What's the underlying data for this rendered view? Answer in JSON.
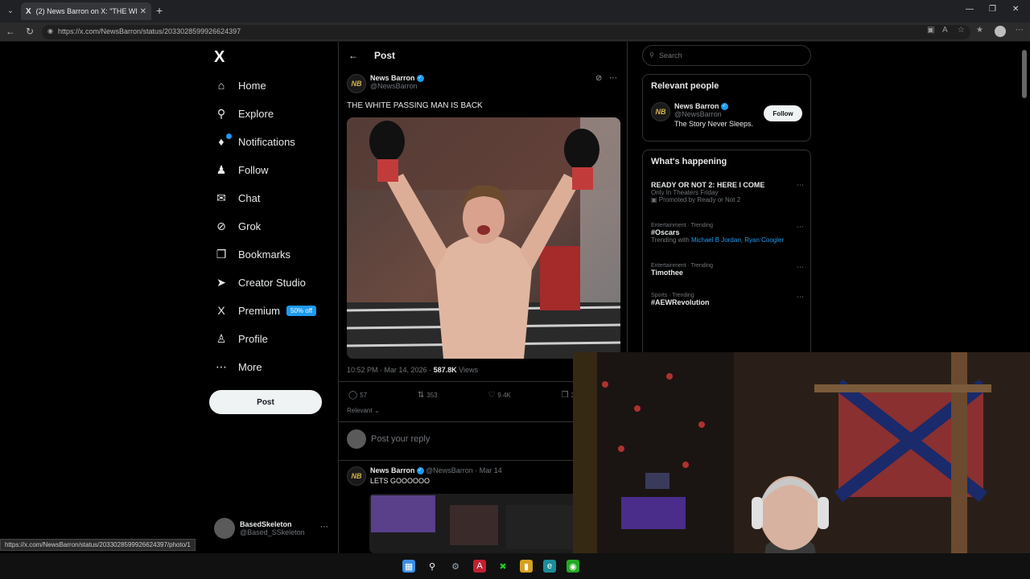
{
  "browser": {
    "tab_title": "(2) News Barron on X: \"THE WHIT",
    "tab_favicon": "X",
    "url": "https://x.com/NewsBarron/status/2033028599926624397",
    "status_url": "https://x.com/NewsBarron/status/2033028599926624397/photo/1"
  },
  "nav": {
    "logo": "X",
    "items": [
      {
        "label": "Home",
        "icon": "home-icon"
      },
      {
        "label": "Explore",
        "icon": "search-icon"
      },
      {
        "label": "Notifications",
        "icon": "bell-icon"
      },
      {
        "label": "Follow",
        "icon": "add-person-icon"
      },
      {
        "label": "Chat",
        "icon": "mail-icon"
      },
      {
        "label": "Grok",
        "icon": "grok-icon"
      },
      {
        "label": "Bookmarks",
        "icon": "bookmark-icon"
      },
      {
        "label": "Creator Studio",
        "icon": "rocket-icon"
      },
      {
        "label": "Premium",
        "icon": "x-icon"
      },
      {
        "label": "Profile",
        "icon": "person-icon"
      },
      {
        "label": "More",
        "icon": "more-circle-icon"
      }
    ],
    "premium_badge": "50% off",
    "post_button": "Post"
  },
  "account": {
    "name": "BasedSkeleton",
    "handle": "@Based_SSkeleton"
  },
  "post": {
    "header_title": "Post",
    "author_avatar": "NB",
    "author_name": "News Barron",
    "author_handle": "@NewsBarron",
    "text": "THE WHITE PASSING MAN IS BACK",
    "time": "10:52 PM · Mar 14, 2026 ·",
    "views": "587.8K",
    "views_label": "Views",
    "replies": "57",
    "reposts": "353",
    "likes": "9.4K",
    "bookmarks": "361",
    "sort_label": "Relevant"
  },
  "reply_box": {
    "placeholder": "Post your reply"
  },
  "reply": {
    "name": "News Barron",
    "handle_date": "@NewsBarron · Mar 14",
    "text": "LETS GOOOOOO"
  },
  "right": {
    "search_placeholder": "Search",
    "relevant_title": "Relevant people",
    "person": {
      "name": "News Barron",
      "handle": "@NewsBarron",
      "bio": "The Story Never Sleeps."
    },
    "follow_label": "Follow",
    "happening_title": "What's happening",
    "trends": [
      {
        "category": "",
        "title": "READY OR NOT 2: HERE I COME",
        "sub": "Only In Theaters Friday",
        "sub2": "Promoted by Ready or Not 2"
      },
      {
        "category": "Entertainment · Trending",
        "title": "#Oscars",
        "sub": "Trending with",
        "links": "Michael B Jordan, Ryan Coogler"
      },
      {
        "category": "Entertainment · Trending",
        "title": "Timothee"
      },
      {
        "category": "Sports · Trending",
        "title": "#AEWRevolution"
      }
    ]
  }
}
